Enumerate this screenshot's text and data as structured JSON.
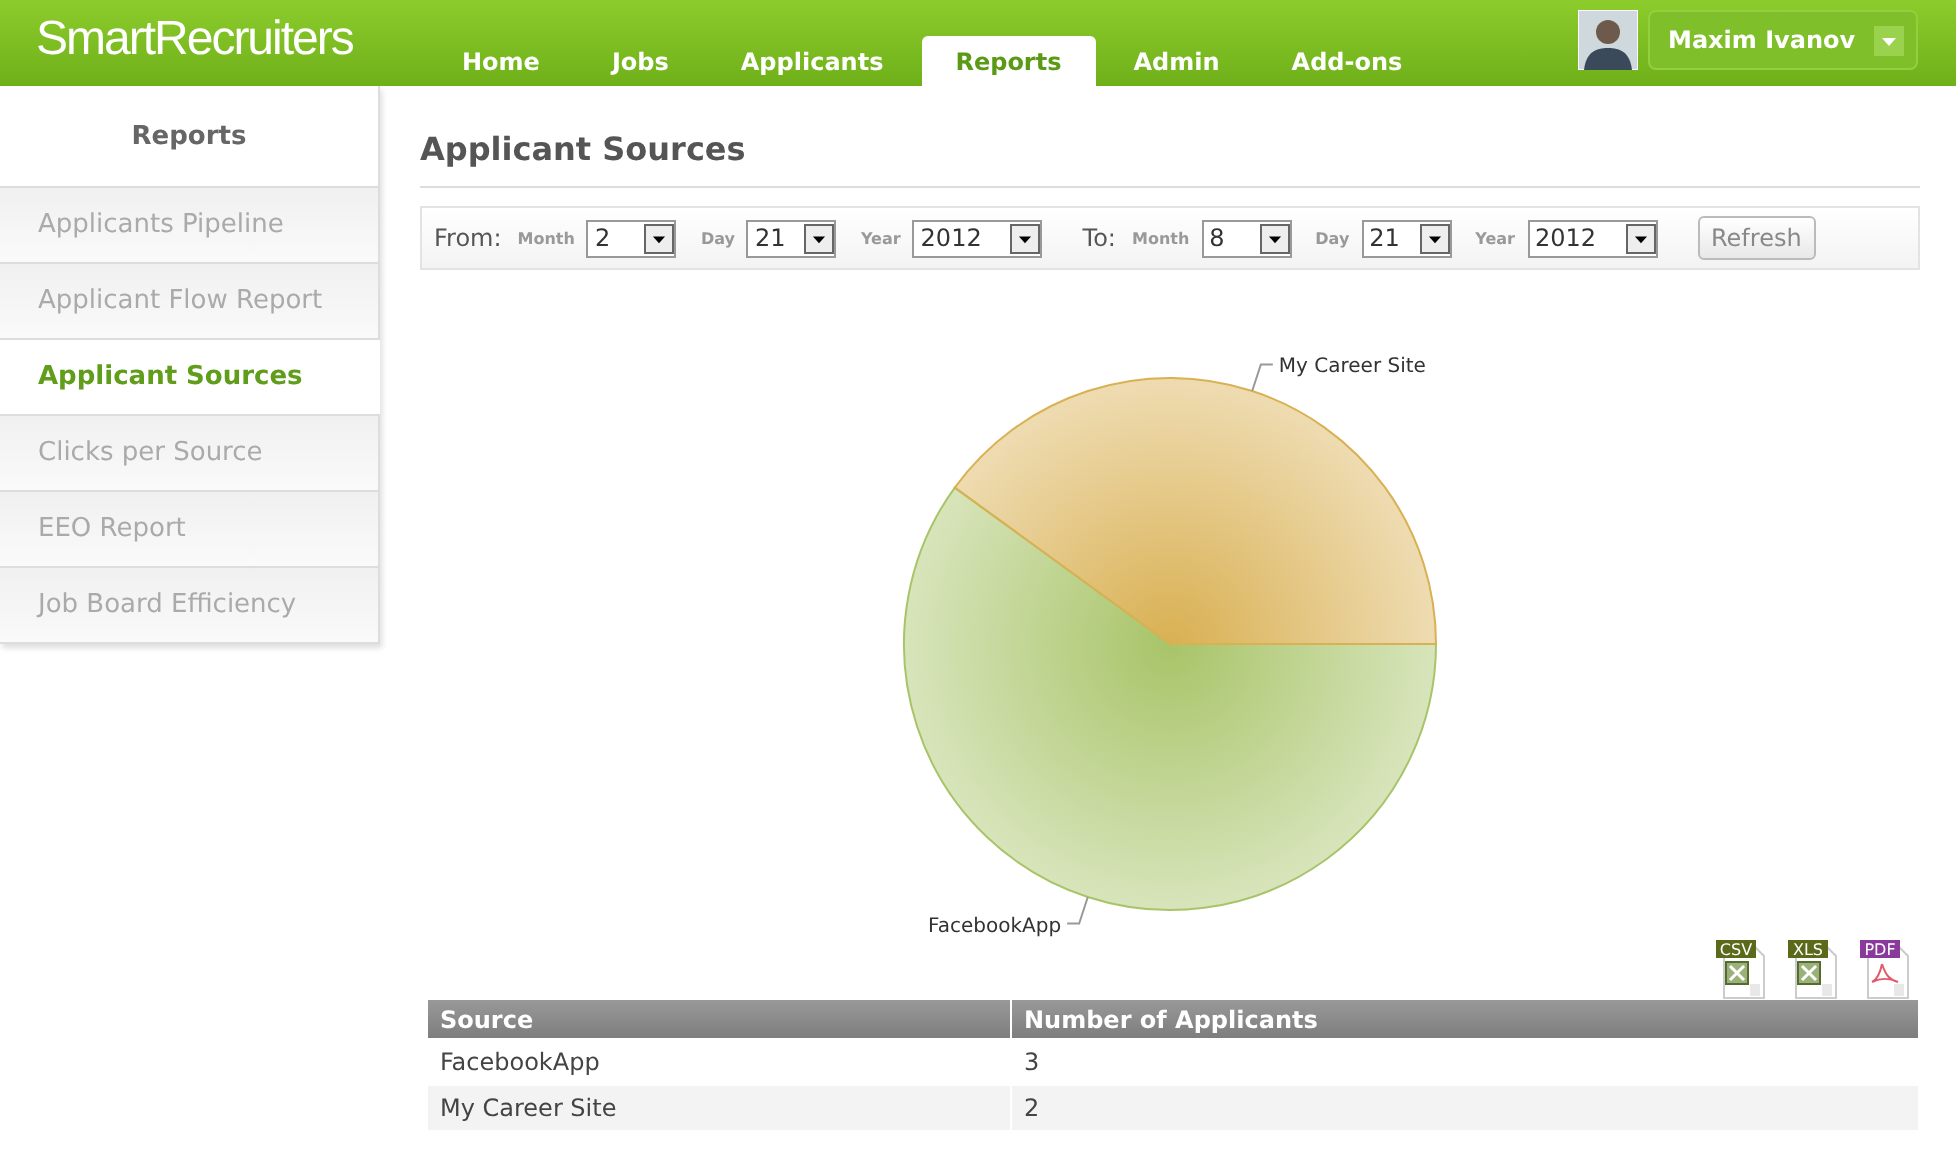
{
  "brand": "SmartRecruiters",
  "nav": [
    {
      "label": "Home",
      "selected": false
    },
    {
      "label": "Jobs",
      "selected": false
    },
    {
      "label": "Applicants",
      "selected": false
    },
    {
      "label": "Reports",
      "selected": true
    },
    {
      "label": "Admin",
      "selected": false
    },
    {
      "label": "Add-ons",
      "selected": false
    }
  ],
  "user": {
    "name": "Maxim Ivanov"
  },
  "sidebar": {
    "title": "Reports",
    "items": [
      {
        "label": "Applicants Pipeline",
        "selected": false
      },
      {
        "label": "Applicant Flow Report",
        "selected": false
      },
      {
        "label": "Applicant Sources",
        "selected": true
      },
      {
        "label": "Clicks per Source",
        "selected": false
      },
      {
        "label": "EEO Report",
        "selected": false
      },
      {
        "label": "Job Board Efficiency",
        "selected": false
      }
    ]
  },
  "page_title": "Applicant Sources",
  "filters": [
    {
      "label": "From:",
      "fields": [
        {
          "label": "Month",
          "value": "2"
        },
        {
          "label": "Day",
          "value": "21"
        },
        {
          "label": "Year",
          "value": "2012"
        }
      ]
    },
    {
      "label": "To:",
      "fields": [
        {
          "label": "Month",
          "value": "8"
        },
        {
          "label": "Day",
          "value": "21"
        },
        {
          "label": "Year",
          "value": "2012"
        }
      ]
    }
  ],
  "refresh": "Refresh",
  "chart_data": {
    "type": "pie",
    "categories": [
      "FacebookApp",
      "My Career Site"
    ],
    "values": [
      60,
      40
    ],
    "colors": [
      "#a8c468",
      "#d9b052"
    ]
  },
  "exports": [
    {
      "label": "CSV",
      "kind": "excel"
    },
    {
      "label": "XLS",
      "kind": "excel"
    },
    {
      "label": "PDF",
      "kind": "pdf"
    }
  ],
  "table": {
    "columns": [
      "Source",
      "Number of Applicants"
    ],
    "rows": [
      [
        "FacebookApp",
        "3"
      ],
      [
        "My Career Site",
        "2"
      ]
    ]
  }
}
